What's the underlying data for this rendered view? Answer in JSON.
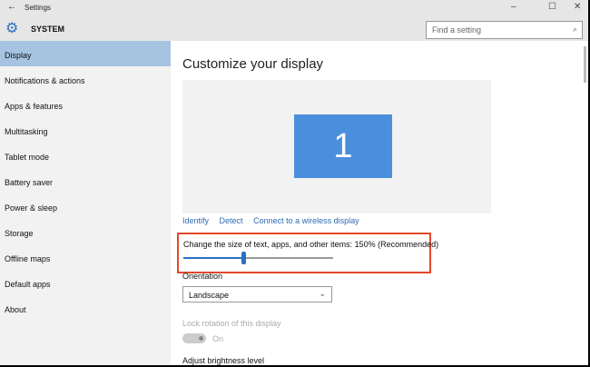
{
  "window": {
    "title": "Settings",
    "back": "←",
    "minimize": "–",
    "maximize": "☐",
    "close": "✕"
  },
  "header": {
    "section": "SYSTEM",
    "search_placeholder": "Find a setting"
  },
  "sidebar": {
    "items": [
      {
        "label": "Display"
      },
      {
        "label": "Notifications & actions"
      },
      {
        "label": "Apps & features"
      },
      {
        "label": "Multitasking"
      },
      {
        "label": "Tablet mode"
      },
      {
        "label": "Battery saver"
      },
      {
        "label": "Power & sleep"
      },
      {
        "label": "Storage"
      },
      {
        "label": "Offline maps"
      },
      {
        "label": "Default apps"
      },
      {
        "label": "About"
      }
    ]
  },
  "main": {
    "title": "Customize your display",
    "monitor_number": "1",
    "links": {
      "identify": "Identify",
      "detect": "Detect",
      "wireless": "Connect to a wireless display"
    },
    "scale": {
      "label": "Change the size of text, apps, and other items: 150% (Recommended)",
      "slider_fraction": 0.4
    },
    "orientation": {
      "label": "Orientation",
      "value": "Landscape"
    },
    "lock": {
      "label": "Lock rotation of this display",
      "state": "On"
    },
    "brightness": {
      "label": "Adjust brightness level"
    }
  },
  "colors": {
    "accent": "#2b6fc0",
    "highlight": "#e2492b",
    "active_item": "#a6c4e2"
  }
}
